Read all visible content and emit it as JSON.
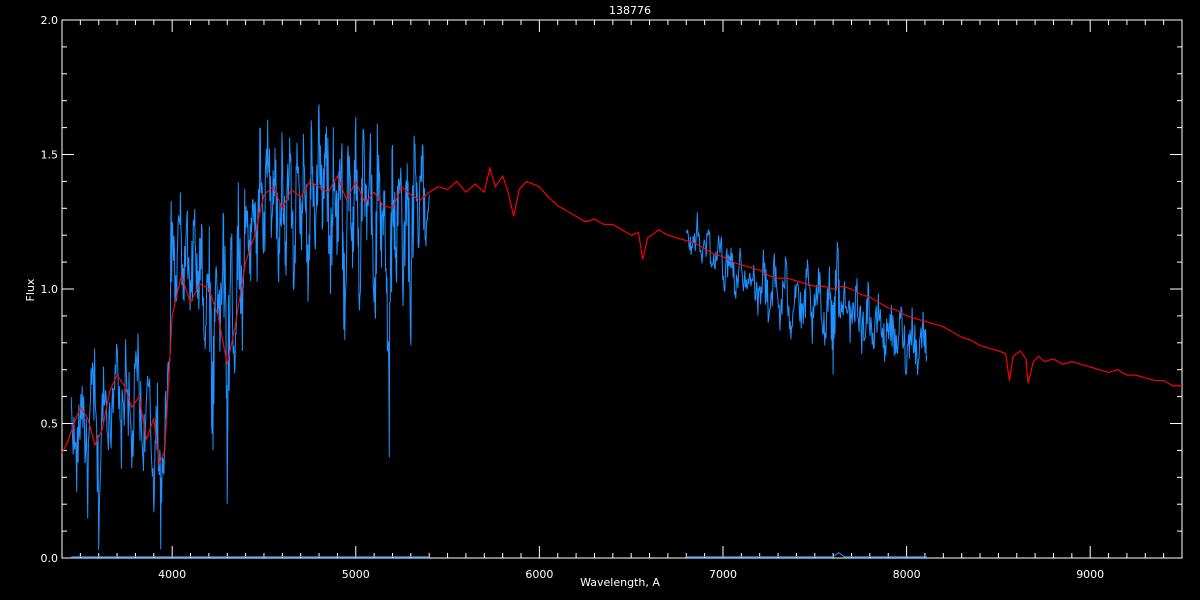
{
  "chart_data": {
    "type": "line",
    "title": "138776",
    "xlabel": "Wavelength, A",
    "ylabel": "Flux",
    "xlim": [
      3400,
      9500
    ],
    "ylim": [
      0.0,
      2.0
    ],
    "xticks": [
      4000,
      5000,
      6000,
      7000,
      8000,
      9000
    ],
    "yticks": [
      "0.0",
      "0.5",
      "1.0",
      "1.5",
      "2.0"
    ],
    "series_colors": {
      "model": "#ff0000",
      "observed": "#1e90ff",
      "error": "#1e90ff"
    },
    "series": [
      {
        "id": "model",
        "points": [
          [
            3400,
            0.39
          ],
          [
            3430,
            0.43
          ],
          [
            3460,
            0.49
          ],
          [
            3500,
            0.56
          ],
          [
            3540,
            0.52
          ],
          [
            3580,
            0.42
          ],
          [
            3620,
            0.48
          ],
          [
            3660,
            0.62
          ],
          [
            3700,
            0.68
          ],
          [
            3740,
            0.64
          ],
          [
            3780,
            0.56
          ],
          [
            3820,
            0.6
          ],
          [
            3860,
            0.44
          ],
          [
            3900,
            0.52
          ],
          [
            3930,
            0.35
          ],
          [
            3960,
            0.4
          ],
          [
            4000,
            0.9
          ],
          [
            4050,
            1.05
          ],
          [
            4100,
            0.95
          ],
          [
            4150,
            1.02
          ],
          [
            4200,
            1.0
          ],
          [
            4250,
            0.9
          ],
          [
            4300,
            0.72
          ],
          [
            4340,
            0.85
          ],
          [
            4400,
            1.1
          ],
          [
            4450,
            1.2
          ],
          [
            4500,
            1.35
          ],
          [
            4550,
            1.38
          ],
          [
            4600,
            1.3
          ],
          [
            4650,
            1.37
          ],
          [
            4700,
            1.34
          ],
          [
            4750,
            1.4
          ],
          [
            4800,
            1.38
          ],
          [
            4850,
            1.36
          ],
          [
            4900,
            1.42
          ],
          [
            4950,
            1.33
          ],
          [
            5000,
            1.4
          ],
          [
            5050,
            1.32
          ],
          [
            5100,
            1.36
          ],
          [
            5150,
            1.31
          ],
          [
            5200,
            1.3
          ],
          [
            5250,
            1.38
          ],
          [
            5300,
            1.35
          ],
          [
            5350,
            1.33
          ],
          [
            5400,
            1.36
          ],
          [
            5450,
            1.38
          ],
          [
            5500,
            1.37
          ],
          [
            5550,
            1.4
          ],
          [
            5600,
            1.36
          ],
          [
            5650,
            1.39
          ],
          [
            5700,
            1.36
          ],
          [
            5730,
            1.45
          ],
          [
            5760,
            1.38
          ],
          [
            5800,
            1.42
          ],
          [
            5830,
            1.36
          ],
          [
            5860,
            1.27
          ],
          [
            5890,
            1.37
          ],
          [
            5930,
            1.4
          ],
          [
            6000,
            1.38
          ],
          [
            6050,
            1.34
          ],
          [
            6100,
            1.31
          ],
          [
            6150,
            1.29
          ],
          [
            6200,
            1.27
          ],
          [
            6250,
            1.25
          ],
          [
            6300,
            1.26
          ],
          [
            6350,
            1.24
          ],
          [
            6400,
            1.24
          ],
          [
            6450,
            1.22
          ],
          [
            6500,
            1.2
          ],
          [
            6540,
            1.21
          ],
          [
            6563,
            1.11
          ],
          [
            6590,
            1.19
          ],
          [
            6650,
            1.22
          ],
          [
            6700,
            1.2
          ],
          [
            6750,
            1.19
          ],
          [
            6800,
            1.18
          ],
          [
            6850,
            1.17
          ],
          [
            6900,
            1.15
          ],
          [
            6950,
            1.13
          ],
          [
            7000,
            1.12
          ],
          [
            7050,
            1.1
          ],
          [
            7100,
            1.09
          ],
          [
            7150,
            1.08
          ],
          [
            7200,
            1.07
          ],
          [
            7250,
            1.05
          ],
          [
            7300,
            1.04
          ],
          [
            7350,
            1.04
          ],
          [
            7400,
            1.03
          ],
          [
            7450,
            1.02
          ],
          [
            7500,
            1.01
          ],
          [
            7550,
            1.01
          ],
          [
            7600,
            1.0
          ],
          [
            7650,
            1.01
          ],
          [
            7700,
            1.0
          ],
          [
            7750,
            0.98
          ],
          [
            7800,
            0.97
          ],
          [
            7850,
            0.95
          ],
          [
            7900,
            0.93
          ],
          [
            7950,
            0.92
          ],
          [
            8000,
            0.9
          ],
          [
            8050,
            0.89
          ],
          [
            8100,
            0.88
          ],
          [
            8150,
            0.87
          ],
          [
            8200,
            0.86
          ],
          [
            8250,
            0.84
          ],
          [
            8300,
            0.82
          ],
          [
            8350,
            0.81
          ],
          [
            8400,
            0.79
          ],
          [
            8450,
            0.78
          ],
          [
            8500,
            0.77
          ],
          [
            8540,
            0.76
          ],
          [
            8560,
            0.66
          ],
          [
            8580,
            0.75
          ],
          [
            8620,
            0.77
          ],
          [
            8650,
            0.74
          ],
          [
            8662,
            0.65
          ],
          [
            8690,
            0.73
          ],
          [
            8720,
            0.75
          ],
          [
            8750,
            0.73
          ],
          [
            8800,
            0.74
          ],
          [
            8850,
            0.72
          ],
          [
            8900,
            0.73
          ],
          [
            8950,
            0.72
          ],
          [
            9000,
            0.71
          ],
          [
            9050,
            0.7
          ],
          [
            9100,
            0.69
          ],
          [
            9150,
            0.7
          ],
          [
            9200,
            0.68
          ],
          [
            9250,
            0.68
          ],
          [
            9300,
            0.67
          ],
          [
            9350,
            0.66
          ],
          [
            9400,
            0.66
          ],
          [
            9450,
            0.64
          ],
          [
            9500,
            0.64
          ]
        ]
      },
      {
        "id": "observed",
        "segments": [
          {
            "points": [
              [
                3450,
                0.55
              ],
              [
                3480,
                0.35
              ],
              [
                3510,
                0.62
              ],
              [
                3540,
                0.3
              ],
              [
                3570,
                0.7
              ],
              [
                3600,
                0.2
              ],
              [
                3630,
                0.66
              ],
              [
                3660,
                0.45
              ],
              [
                3690,
                0.78
              ],
              [
                3720,
                0.42
              ],
              [
                3750,
                0.72
              ],
              [
                3780,
                0.38
              ],
              [
                3810,
                0.75
              ],
              [
                3840,
                0.4
              ],
              [
                3870,
                0.62
              ],
              [
                3900,
                0.28
              ],
              [
                3920,
                0.55
              ],
              [
                3940,
                0.15
              ],
              [
                3960,
                0.5
              ],
              [
                3980,
                0.72
              ],
              [
                4000,
                1.25
              ],
              [
                4020,
                0.95
              ],
              [
                4040,
                1.3
              ],
              [
                4060,
                1.0
              ],
              [
                4080,
                1.2
              ],
              [
                4100,
                0.9
              ],
              [
                4120,
                1.25
              ],
              [
                4140,
                0.95
              ],
              [
                4160,
                1.2
              ],
              [
                4180,
                0.8
              ],
              [
                4200,
                1.15
              ],
              [
                4220,
                0.55
              ],
              [
                4240,
                1.1
              ],
              [
                4260,
                0.85
              ],
              [
                4280,
                1.2
              ],
              [
                4300,
                0.45
              ],
              [
                4320,
                1.15
              ],
              [
                4340,
                0.75
              ],
              [
                4360,
                1.25
              ],
              [
                4380,
                0.9
              ],
              [
                4400,
                1.35
              ],
              [
                4420,
                1.05
              ],
              [
                4440,
                1.4
              ],
              [
                4460,
                1.1
              ],
              [
                4480,
                1.5
              ],
              [
                4500,
                1.15
              ],
              [
                4520,
                1.55
              ],
              [
                4540,
                1.2
              ],
              [
                4560,
                1.45
              ],
              [
                4580,
                1.1
              ],
              [
                4600,
                1.48
              ],
              [
                4620,
                1.15
              ],
              [
                4640,
                1.5
              ],
              [
                4660,
                1.05
              ],
              [
                4680,
                1.45
              ],
              [
                4700,
                1.2
              ],
              [
                4720,
                1.52
              ],
              [
                4740,
                1.1
              ],
              [
                4760,
                1.55
              ],
              [
                4780,
                1.25
              ],
              [
                4800,
                1.58
              ],
              [
                4820,
                1.3
              ],
              [
                4840,
                1.55
              ],
              [
                4860,
                1.05
              ],
              [
                4880,
                1.48
              ],
              [
                4900,
                1.2
              ],
              [
                4920,
                1.52
              ],
              [
                4940,
                0.85
              ],
              [
                4960,
                1.45
              ],
              [
                4980,
                1.15
              ],
              [
                5000,
                1.5
              ],
              [
                5020,
                1.05
              ],
              [
                5040,
                1.55
              ],
              [
                5060,
                1.2
              ],
              [
                5080,
                1.45
              ],
              [
                5100,
                0.9
              ],
              [
                5120,
                1.48
              ],
              [
                5140,
                1.15
              ],
              [
                5160,
                1.4
              ],
              [
                5180,
                0.58
              ],
              [
                5200,
                1.42
              ],
              [
                5220,
                1.1
              ],
              [
                5240,
                1.45
              ],
              [
                5260,
                1.05
              ],
              [
                5280,
                1.4
              ],
              [
                5300,
                0.9
              ],
              [
                5320,
                1.5
              ],
              [
                5340,
                1.15
              ],
              [
                5360,
                1.48
              ],
              [
                5380,
                1.2
              ],
              [
                5400,
                1.35
              ]
            ]
          },
          {
            "points": [
              [
                6800,
                1.2
              ],
              [
                6830,
                1.15
              ],
              [
                6860,
                1.22
              ],
              [
                6890,
                1.12
              ],
              [
                6920,
                1.2
              ],
              [
                6950,
                1.08
              ],
              [
                6980,
                1.17
              ],
              [
                7010,
                1.05
              ],
              [
                7040,
                1.15
              ],
              [
                7070,
                1.02
              ],
              [
                7100,
                1.12
              ],
              [
                7130,
                0.98
              ],
              [
                7160,
                1.1
              ],
              [
                7190,
                0.95
              ],
              [
                7220,
                1.08
              ],
              [
                7250,
                0.92
              ],
              [
                7280,
                1.06
              ],
              [
                7310,
                0.9
              ],
              [
                7340,
                1.05
              ],
              [
                7370,
                0.88
              ],
              [
                7400,
                1.04
              ],
              [
                7430,
                0.86
              ],
              [
                7460,
                1.03
              ],
              [
                7490,
                0.85
              ],
              [
                7520,
                1.02
              ],
              [
                7550,
                0.84
              ],
              [
                7580,
                1.04
              ],
              [
                7600,
                0.8
              ],
              [
                7620,
                1.15
              ],
              [
                7640,
                0.88
              ],
              [
                7670,
                1.02
              ],
              [
                7700,
                0.83
              ],
              [
                7730,
                0.98
              ],
              [
                7760,
                0.82
              ],
              [
                7790,
                0.96
              ],
              [
                7820,
                0.8
              ],
              [
                7850,
                0.93
              ],
              [
                7880,
                0.78
              ],
              [
                7910,
                0.9
              ],
              [
                7940,
                0.76
              ],
              [
                7970,
                0.89
              ],
              [
                8000,
                0.74
              ],
              [
                8030,
                0.88
              ],
              [
                8060,
                0.73
              ],
              [
                8090,
                0.87
              ],
              [
                8110,
                0.75
              ]
            ]
          }
        ]
      },
      {
        "id": "error",
        "segments": [
          {
            "points": [
              [
                3450,
                0.005
              ],
              [
                5400,
                0.005
              ]
            ]
          },
          {
            "points": [
              [
                6800,
                0.005
              ],
              [
                7600,
                0.005
              ],
              [
                7630,
                0.02
              ],
              [
                7660,
                0.005
              ],
              [
                8110,
                0.005
              ]
            ]
          }
        ]
      }
    ]
  }
}
